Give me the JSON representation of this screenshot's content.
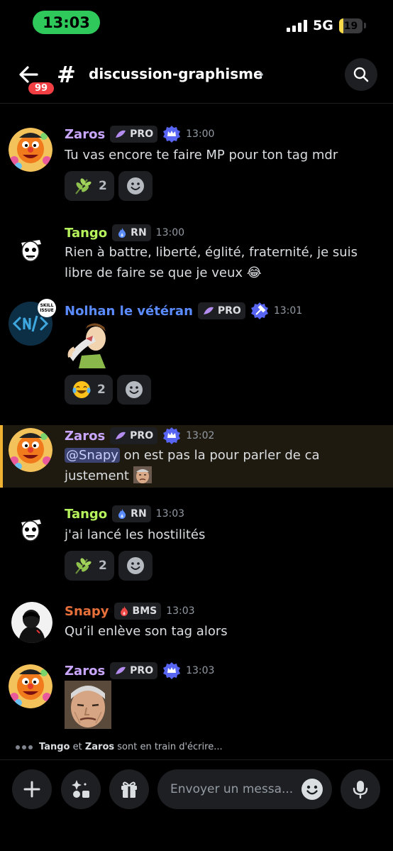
{
  "status": {
    "time": "13:03",
    "network": "5G",
    "battery": "19",
    "battery_level": 0.19
  },
  "header": {
    "unread_badge": "99",
    "channel": "discussion-graphisme"
  },
  "messages": [
    {
      "author": "Zaros",
      "author_color": "#c9a6ff",
      "tag": "PRO",
      "time": "13:00",
      "text": "Tu vas encore te faire MP pour ton tag mdr",
      "reaction_count": "2"
    },
    {
      "author": "Tango",
      "author_color": "#b5f25c",
      "tag": "RN",
      "time": "13:00",
      "text": "Rien à battre, liberté, églité, fraternité, je suis libre de faire se que je veux 😂"
    },
    {
      "author": "Nolhan le vétéran",
      "author_color": "#5b8cff",
      "tag": "PRO",
      "time": "13:01",
      "avatar_label": "SKILL ISSUE",
      "reaction_count": "2"
    },
    {
      "author": "Zaros",
      "author_color": "#c9a6ff",
      "tag": "PRO",
      "time": "13:02",
      "mention": "@Snapy",
      "text": " on est pas la pour parler de ca justement"
    },
    {
      "author": "Tango",
      "author_color": "#b5f25c",
      "tag": "RN",
      "time": "13:03",
      "text": "j'ai lancé les hostilités",
      "reaction_count": "2"
    },
    {
      "author": "Snapy",
      "author_color": "#e8703a",
      "tag": "BMS",
      "time": "13:03",
      "text": "Qu’il enlève son tag alors"
    },
    {
      "author": "Zaros",
      "author_color": "#c9a6ff",
      "tag": "PRO",
      "time": "13:03"
    }
  ],
  "typing": {
    "user1": "Tango",
    "joiner": " et ",
    "user2": "Zaros",
    "suffix": " sont en train d'écrire..."
  },
  "composer": {
    "placeholder": "Envoyer un messa..."
  }
}
